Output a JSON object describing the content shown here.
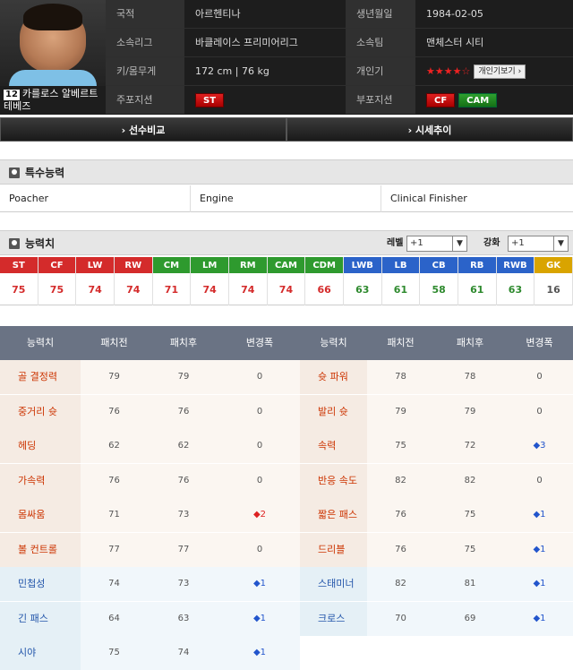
{
  "player": {
    "number": "12",
    "name": "카를로스 알베르트 테베즈",
    "photo_icon": "player-photo"
  },
  "info": [
    {
      "l1": "국적",
      "v1": "아르헨티나",
      "l2": "생년월일",
      "v2": "1984-02-05"
    },
    {
      "l1": "소속리그",
      "v1": "바클레이스 프리미어리그",
      "l2": "소속팀",
      "v2": "맨체스터 시티"
    },
    {
      "l1": "키/몸무게",
      "v1": "172 cm | 76 kg",
      "l2": "개인기",
      "v2": "★★★★☆"
    },
    {
      "l1": "주포지션",
      "v1": "ST",
      "l2": "부포지션",
      "v2a": "CF",
      "v2b": "CAM"
    }
  ],
  "skill_button": "개인기보기 ›",
  "buttons": {
    "compare": "› 선수비교",
    "price": "› 시세추이"
  },
  "traits_title": "특수능력",
  "traits": [
    "Poacher",
    "Engine",
    "Clinical Finisher"
  ],
  "ability_title": "능력치",
  "level": {
    "label": "레벨",
    "value": "+1"
  },
  "enhance": {
    "label": "강화",
    "value": "+1"
  },
  "positions": [
    {
      "p": "ST",
      "v": "75",
      "c": "#d42b2b",
      "vc": "#d42b2b"
    },
    {
      "p": "CF",
      "v": "75",
      "c": "#d42b2b",
      "vc": "#d42b2b"
    },
    {
      "p": "LW",
      "v": "74",
      "c": "#d42b2b",
      "vc": "#d42b2b"
    },
    {
      "p": "RW",
      "v": "74",
      "c": "#d42b2b",
      "vc": "#d42b2b"
    },
    {
      "p": "CM",
      "v": "71",
      "c": "#2e9a2e",
      "vc": "#d42b2b"
    },
    {
      "p": "LM",
      "v": "74",
      "c": "#2e9a2e",
      "vc": "#d42b2b"
    },
    {
      "p": "RM",
      "v": "74",
      "c": "#2e9a2e",
      "vc": "#d42b2b"
    },
    {
      "p": "CAM",
      "v": "74",
      "c": "#2e9a2e",
      "vc": "#d42b2b"
    },
    {
      "p": "CDM",
      "v": "66",
      "c": "#2e9a2e",
      "vc": "#d42b2b"
    },
    {
      "p": "LWB",
      "v": "63",
      "c": "#2b63c9",
      "vc": "#2e8a2e"
    },
    {
      "p": "LB",
      "v": "61",
      "c": "#2b63c9",
      "vc": "#2e8a2e"
    },
    {
      "p": "CB",
      "v": "58",
      "c": "#2b63c9",
      "vc": "#2e8a2e"
    },
    {
      "p": "RB",
      "v": "61",
      "c": "#2b63c9",
      "vc": "#2e8a2e"
    },
    {
      "p": "RWB",
      "v": "63",
      "c": "#2b63c9",
      "vc": "#2e8a2e"
    },
    {
      "p": "GK",
      "v": "16",
      "c": "#d9a400",
      "vc": "#555555"
    }
  ],
  "stats_headers": [
    "능력치",
    "패치전",
    "패치후",
    "변경폭",
    "능력치",
    "패치전",
    "패치후",
    "변경폭"
  ],
  "stats_left": [
    {
      "n": "골 결정력",
      "a": "79",
      "b": "79",
      "d": "0",
      "t": "none",
      "g": "warm"
    },
    {
      "n": "중거리 슛",
      "a": "76",
      "b": "76",
      "d": "0",
      "t": "none",
      "g": "warm"
    },
    {
      "n": "헤딩",
      "a": "62",
      "b": "62",
      "d": "0",
      "t": "none",
      "g": "warm"
    },
    {
      "n": "가속력",
      "a": "76",
      "b": "76",
      "d": "0",
      "t": "none",
      "g": "warm"
    },
    {
      "n": "몸싸움",
      "a": "71",
      "b": "73",
      "d": "◆2",
      "t": "up2",
      "g": "warm"
    },
    {
      "n": "볼 컨트롤",
      "a": "77",
      "b": "77",
      "d": "0",
      "t": "none",
      "g": "warm"
    },
    {
      "n": "민첩성",
      "a": "74",
      "b": "73",
      "d": "◆1",
      "t": "up",
      "g": "cool"
    },
    {
      "n": "긴 패스",
      "a": "64",
      "b": "63",
      "d": "◆1",
      "t": "up",
      "g": "cool"
    },
    {
      "n": "시야",
      "a": "75",
      "b": "74",
      "d": "◆1",
      "t": "up",
      "g": "cool"
    }
  ],
  "stats_right": [
    {
      "n": "슛 파워",
      "a": "78",
      "b": "78",
      "d": "0",
      "t": "none",
      "g": "warm"
    },
    {
      "n": "발리 슛",
      "a": "79",
      "b": "79",
      "d": "0",
      "t": "none",
      "g": "warm"
    },
    {
      "n": "속력",
      "a": "75",
      "b": "72",
      "d": "◆3",
      "t": "up",
      "g": "warm"
    },
    {
      "n": "반응 속도",
      "a": "82",
      "b": "82",
      "d": "0",
      "t": "none",
      "g": "warm"
    },
    {
      "n": "짧은 패스",
      "a": "76",
      "b": "75",
      "d": "◆1",
      "t": "up",
      "g": "warm"
    },
    {
      "n": "드리블",
      "a": "76",
      "b": "75",
      "d": "◆1",
      "t": "up",
      "g": "warm"
    },
    {
      "n": "스태미너",
      "a": "82",
      "b": "81",
      "d": "◆1",
      "t": "up",
      "g": "cool"
    },
    {
      "n": "크로스",
      "a": "70",
      "b": "69",
      "d": "◆1",
      "t": "up",
      "g": "cool"
    }
  ]
}
